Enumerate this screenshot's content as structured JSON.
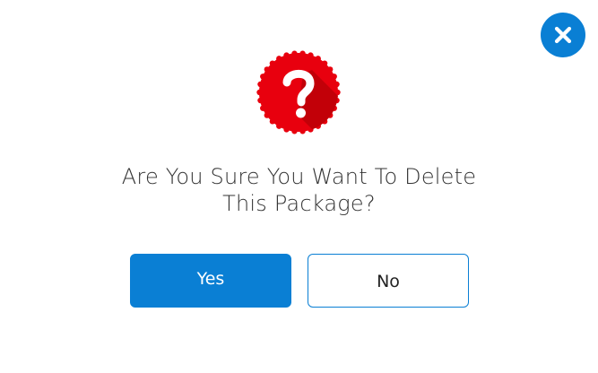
{
  "dialog": {
    "message_line1": "Are You Sure You Want To Delete",
    "message_line2": "This Package?",
    "yes_label": "Yes",
    "no_label": "No",
    "close_icon": "close-icon",
    "badge_icon": "question-icon"
  },
  "colors": {
    "primary": "#0a7fd4",
    "badge": "#e8000e",
    "text": "#333333"
  }
}
